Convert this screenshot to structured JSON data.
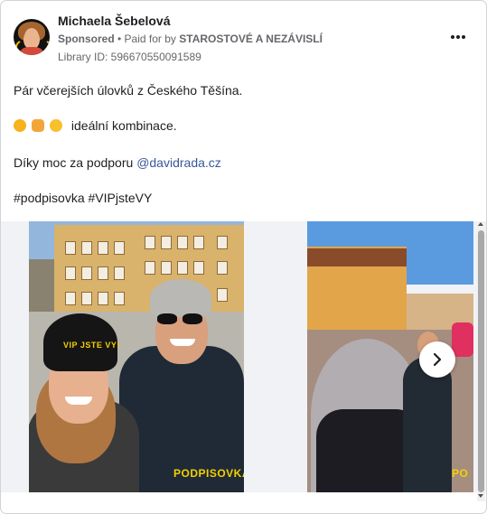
{
  "header": {
    "name": "Michaela Šebelová",
    "sponsored": "Sponsored",
    "paid_for_prefix": "• Paid for by",
    "paid_for_by": "STAROSTOVÉ A NEZÁVISLÍ",
    "library_id": "Library ID: 596670550091589"
  },
  "post": {
    "line1": "Pár včerejších úlovků z Českého Těšína.",
    "line2_text": "ideální kombinace.",
    "line3_prefix": "Díky moc za podporu",
    "line3_mention": "@davidrada.cz",
    "line4": "#podpisovka #VIPjsteVY"
  },
  "media": {
    "slide1_hat_text": "VIP JSTE VY!",
    "slide1_logo": "PODPISOVKA",
    "slide2_logo": "PO"
  },
  "icons": {
    "more": "more-options-icon",
    "next": "chevron-right-icon",
    "emoji1": "sun-emoji",
    "emoji2": "writing-hand-emoji",
    "emoji3": "smiling-face-emoji"
  },
  "colors": {
    "mention": "#385898",
    "logo_yellow": "#f5d000"
  }
}
